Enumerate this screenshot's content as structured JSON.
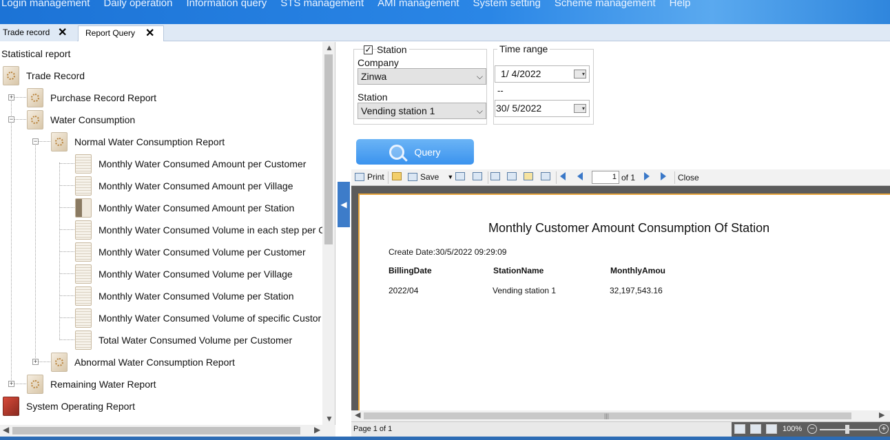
{
  "menu": [
    "Login management",
    "Daily operation",
    "Information query",
    "STS management",
    "AMI management",
    "System setting",
    "Scheme management",
    "Help"
  ],
  "tabs": [
    {
      "label": "Trade record",
      "close": "✕"
    },
    {
      "label": "Report Query",
      "close": "✕"
    }
  ],
  "tree": {
    "header": "Statistical report",
    "items": [
      {
        "label": "Trade Record"
      },
      {
        "label": "Purchase Record Report"
      },
      {
        "label": "Water Consumption"
      },
      {
        "label": "Normal Water Consumption Report"
      },
      {
        "label": "Monthly Water Consumed Amount per Customer"
      },
      {
        "label": "Monthly Water Consumed Amount per Village"
      },
      {
        "label": "Monthly Water Consumed Amount per Station"
      },
      {
        "label": "Monthly Water Consumed Volume in each step per C"
      },
      {
        "label": "Monthly Water Consumed Volume per Customer"
      },
      {
        "label": "Monthly Water Consumed Volume per Village"
      },
      {
        "label": "Monthly Water Consumed Volume per Station"
      },
      {
        "label": "Monthly Water Consumed Volume of specific Custor"
      },
      {
        "label": "Total Water Consumed Volume per Customer"
      },
      {
        "label": "Abnormal Water Consumption Report"
      },
      {
        "label": "Remaining Water Report"
      },
      {
        "label": "System Operating Report"
      }
    ]
  },
  "filter": {
    "station_legend": "Station",
    "company_label": "Company",
    "company_value": "Zinwa",
    "station_label": "Station",
    "station_value": "Vending station 1",
    "time_range_legend": "Time range",
    "date_from": "1/  4/2022",
    "date_separator": "--",
    "date_to": "30/  5/2022",
    "query_label": "Query"
  },
  "viewer": {
    "toolbar": {
      "print": "Print",
      "save": "Save",
      "page_value": "1",
      "page_of": "of 1",
      "close": "Close"
    },
    "report": {
      "title": "Monthly Customer Amount Consumption Of Station",
      "create_date": "Create Date:30/5/2022 09:29:09",
      "headers": [
        "BillingDate",
        "StationName",
        "MonthlyAmou"
      ],
      "rows": [
        [
          "2022/04",
          "Vending station 1",
          "32,197,543.16"
        ]
      ]
    },
    "status": {
      "page": "Page 1 of 1",
      "zoom": "100%"
    }
  }
}
